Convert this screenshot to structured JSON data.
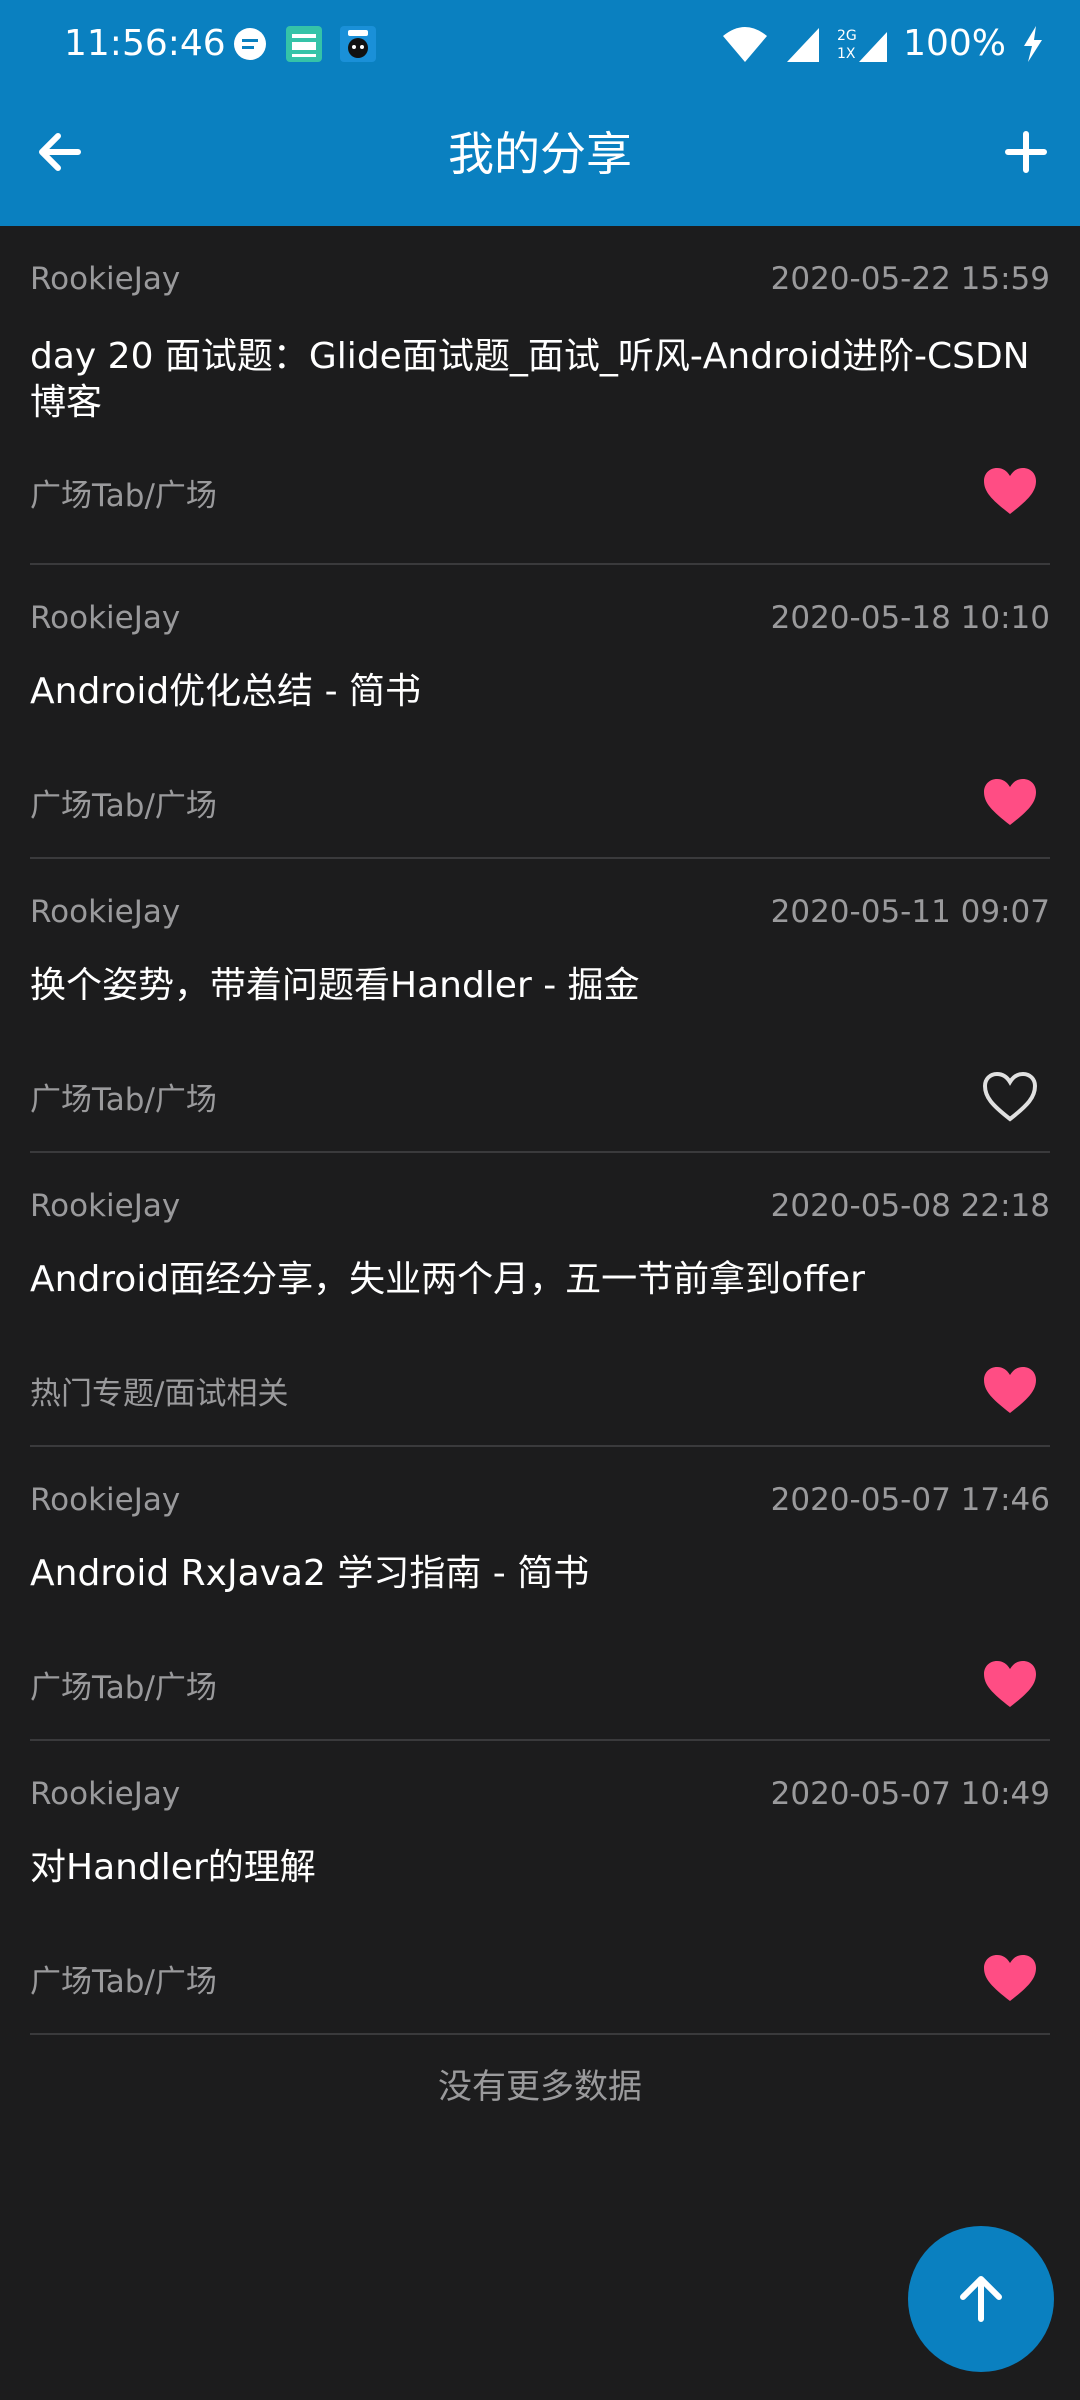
{
  "status_bar": {
    "time": "11:56:46",
    "battery": "100%",
    "network": "2G 1X"
  },
  "app_bar": {
    "title": "我的分享",
    "back_icon": "arrow-left-icon",
    "add_icon": "plus-icon"
  },
  "colors": {
    "primary": "#0a80c0",
    "background": "#1c1c1d",
    "liked": "#ff4d84",
    "muted_text": "#9a9a9c"
  },
  "articles": [
    {
      "author": "RookieJay",
      "date": "2020-05-22 15:59",
      "title": "day 20 面试题：Glide面试题_面试_听风-Android进阶-CSDN博客",
      "chapter": "广场Tab/广场",
      "liked": true
    },
    {
      "author": "RookieJay",
      "date": "2020-05-18 10:10",
      "title": "Android优化总结 - 简书",
      "chapter": "广场Tab/广场",
      "liked": true
    },
    {
      "author": "RookieJay",
      "date": "2020-05-11 09:07",
      "title": "换个姿势，带着问题看Handler - 掘金",
      "chapter": "广场Tab/广场",
      "liked": false
    },
    {
      "author": "RookieJay",
      "date": "2020-05-08 22:18",
      "title": "Android面经分享，失业两个月，五一节前拿到offer",
      "chapter": "热门专题/面试相关",
      "liked": true
    },
    {
      "author": "RookieJay",
      "date": "2020-05-07 17:46",
      "title": "Android RxJava2 学习指南 - 简书",
      "chapter": "广场Tab/广场",
      "liked": true
    },
    {
      "author": "RookieJay",
      "date": "2020-05-07 10:49",
      "title": "对Handler的理解",
      "chapter": "广场Tab/广场",
      "liked": true
    }
  ],
  "footer": {
    "no_more": "没有更多数据"
  },
  "fab": {
    "icon": "arrow-up-icon"
  }
}
